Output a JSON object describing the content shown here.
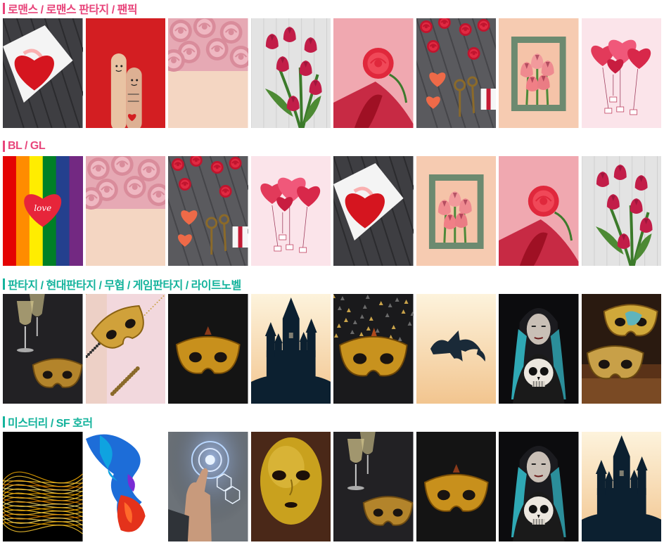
{
  "colors": {
    "pink_heading": "#e8457b",
    "teal_heading": "#14b39c"
  },
  "sections": [
    {
      "title": "로맨스 / 로맨스 판타지 / 팬픽",
      "color": "#e8457b",
      "thumbs": [
        "envelope-heart",
        "finger-couple",
        "pink-roses",
        "tulip-bouquet",
        "rose-ribbon",
        "roses-keys",
        "tulip-frame",
        "heart-balloons"
      ]
    },
    {
      "title": "BL / GL",
      "color": "#e8457b",
      "thumbs": [
        "rainbow-heart",
        "pink-roses",
        "roses-keys",
        "heart-balloons",
        "envelope-heart",
        "tulip-frame",
        "rose-ribbon",
        "tulip-bouquet"
      ]
    },
    {
      "title": "판타지 / 현대판타지 / 무협 / 게임판타지 / 라이트노벨",
      "color": "#14b39c",
      "thumbs": [
        "champagne-mask",
        "mask-glitter",
        "gold-mask",
        "castle-silhouette",
        "gold-mask-confetti",
        "dragon-silhouette",
        "woman-skull",
        "masks-books"
      ]
    },
    {
      "title": "미스터리 / SF 호러",
      "color": "#14b39c",
      "thumbs": [
        "golden-lines",
        "ink-smoke",
        "tech-hand",
        "gold-face-mask",
        "champagne-mask",
        "gold-mask",
        "woman-skull",
        "castle-silhouette"
      ]
    }
  ],
  "rainbow_heart_text": "love"
}
